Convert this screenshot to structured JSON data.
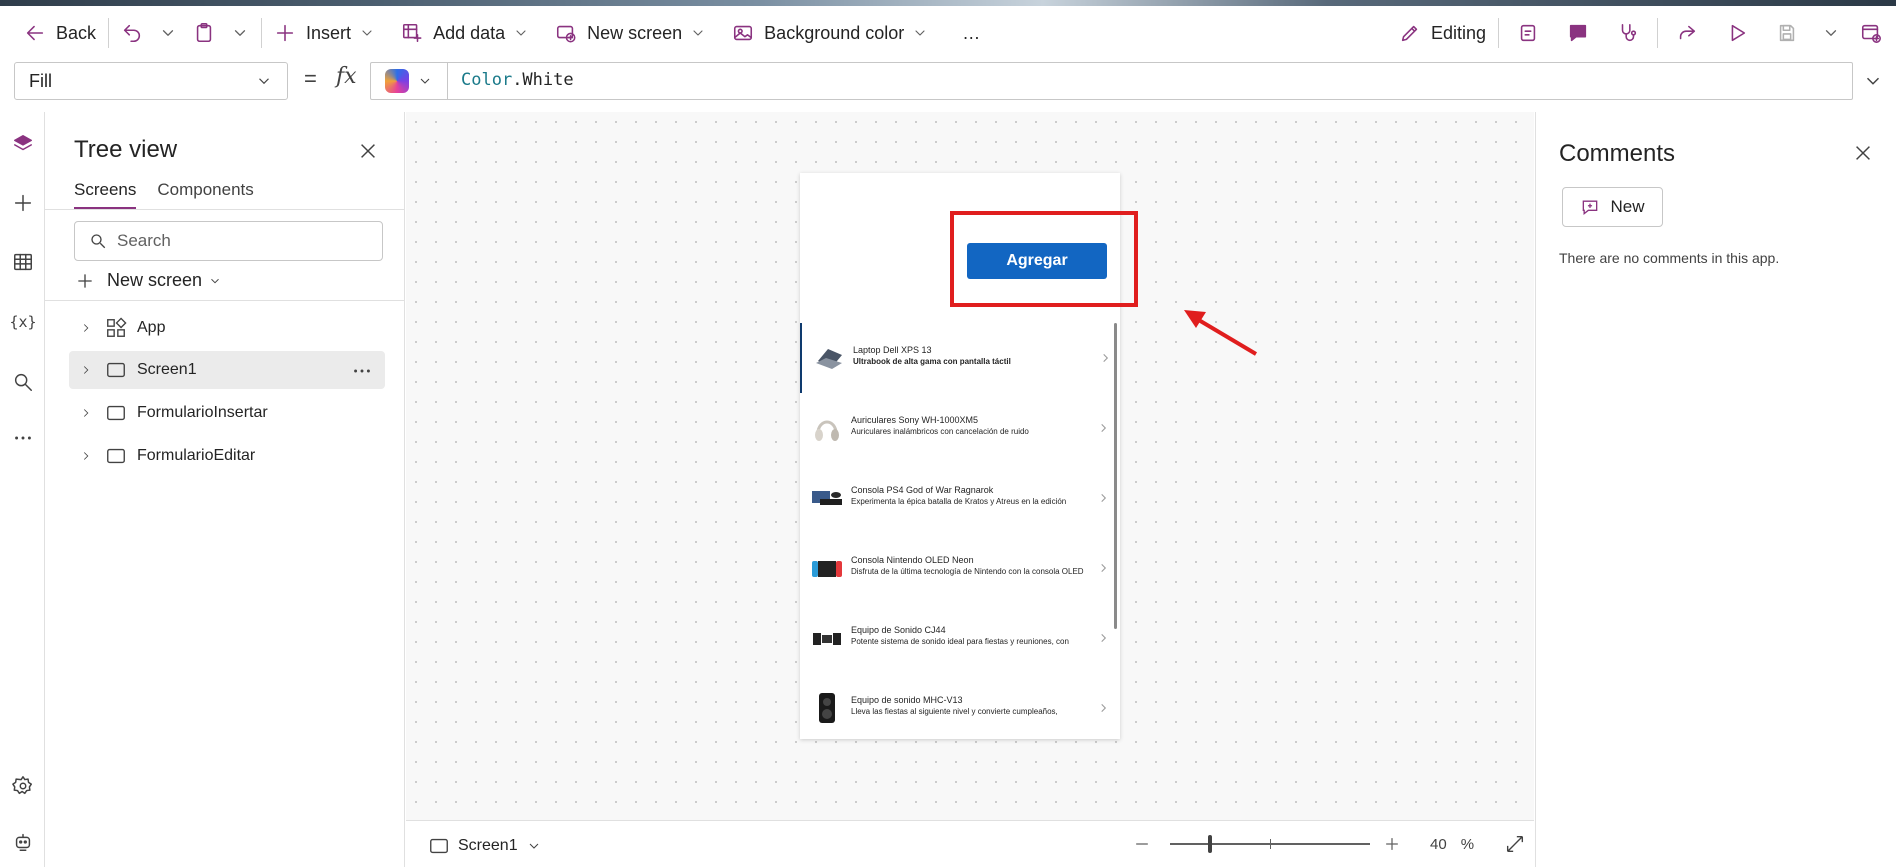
{
  "toolbar": {
    "back": "Back",
    "insert": "Insert",
    "add_data": "Add data",
    "new_screen": "New screen",
    "background_color": "Background color",
    "more": "…",
    "editing": "Editing"
  },
  "formula_bar": {
    "property": "Fill",
    "equals": "=",
    "fx": "fx",
    "formula_keyword": "Color",
    "formula_rest": ".White"
  },
  "tree": {
    "title": "Tree view",
    "tabs": [
      "Screens",
      "Components"
    ],
    "search_placeholder": "Search",
    "new_screen": "New screen",
    "nodes": [
      "App",
      "Screen1",
      "FormularioInsertar",
      "FormularioEditar"
    ]
  },
  "app_preview": {
    "button_label": "Agregar",
    "items": [
      {
        "title": "Laptop Dell XPS 13",
        "subtitle": "Ultrabook de alta gama con pantalla táctil"
      },
      {
        "title": "Auriculares Sony WH-1000XM5",
        "subtitle": "Auriculares inalámbricos con cancelación de ruido"
      },
      {
        "title": "Consola PS4 God of War Ragnarok",
        "subtitle": "Experimenta la épica batalla de Kratos y Atreus en la edición"
      },
      {
        "title": "Consola Nintendo OLED Neon",
        "subtitle": "Disfruta de la última tecnología de Nintendo con la consola OLED"
      },
      {
        "title": "Equipo de Sonido CJ44",
        "subtitle": "Potente sistema de sonido ideal para fiestas y reuniones, con"
      },
      {
        "title": "Equipo de sonido MHC-V13",
        "subtitle": "Lleva las fiestas al siguiente nivel y convierte cumpleaños,"
      }
    ]
  },
  "statusbar": {
    "screen": "Screen1",
    "zoom_value": "40",
    "zoom_unit": "%"
  },
  "comments": {
    "title": "Comments",
    "new_button": "New",
    "empty_text": "There are no comments in this app."
  },
  "colors": {
    "accent": "#8a3380",
    "button_blue": "#1266c2",
    "highlight_red": "#e01e1e"
  }
}
